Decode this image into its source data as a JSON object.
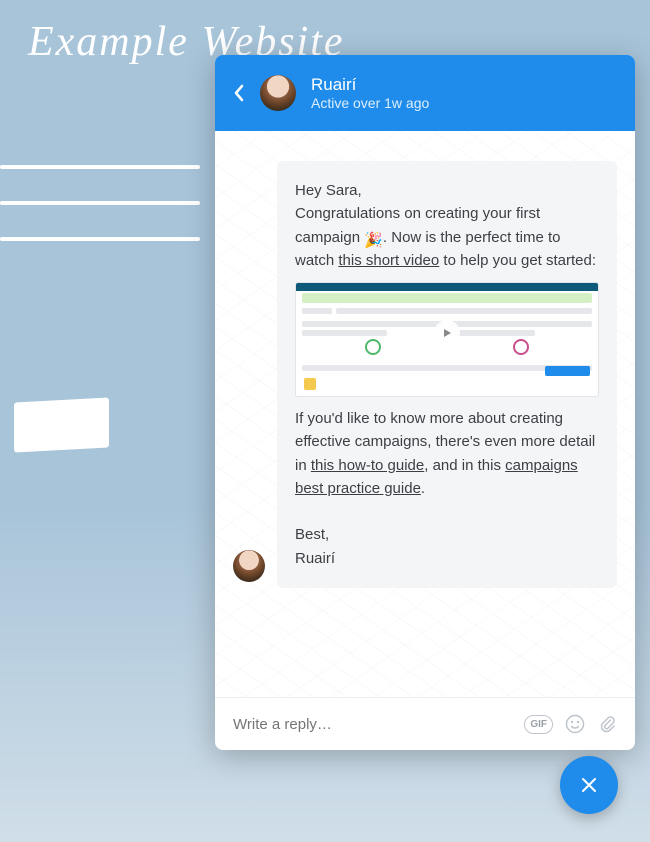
{
  "background": {
    "title": "Example Website"
  },
  "chat": {
    "header": {
      "agent_name": "Ruairí",
      "status": "Active over 1w ago"
    },
    "message": {
      "greeting": "Hey Sara,",
      "line1_a": "Congratulations on creating your first campaign ",
      "line1_emoji": "🎉",
      "line1_b": ". Now is the perfect time to watch ",
      "link_video": "this short video",
      "line1_c": " to help you get started:",
      "line2_a": "If you'd like to know more about creating effective campaigns, there's even more detail in ",
      "link_howto": "this how-to guide",
      "line2_b": ", and in this ",
      "link_best": "campaigns best practice guide",
      "line2_c": ".",
      "signoff1": "Best,",
      "signoff2": "Ruairí"
    },
    "footer": {
      "placeholder": "Write a reply…",
      "gif_label": "GIF"
    }
  }
}
